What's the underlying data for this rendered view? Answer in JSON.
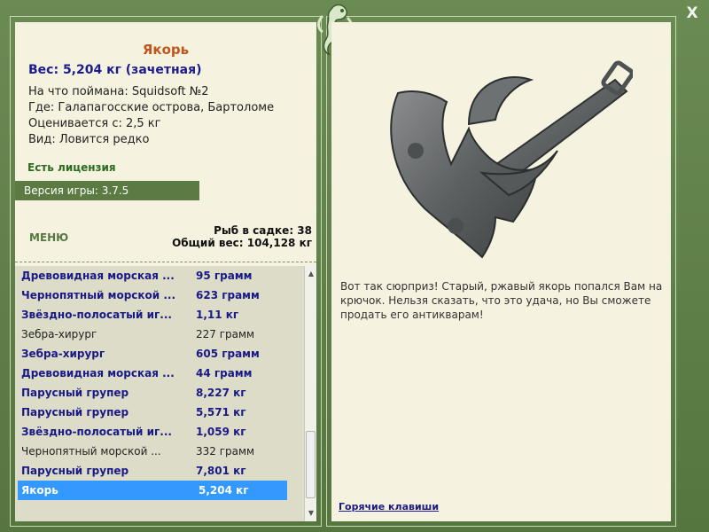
{
  "fish": {
    "title": "Якорь",
    "weight": "Вес: 5,204 кг (зачетная)",
    "info": [
      "На что поймана: Squidsoft №2",
      "Где: Галапагосские острова, Бартоломе",
      "Оценивается с: 2,5 кг",
      "Вид: Ловится редко"
    ],
    "description": "Вот так сюрприз! Старый, ржавый якорь попался Вам на крючок. Нельзя сказать, что это удача, но Вы сможете продать его антикварам!"
  },
  "license": "Есть лицензия",
  "version": "Версия игры: 3.7.5",
  "menu_label": "МЕНЮ",
  "stats": {
    "fish_count": "Рыб в садке: 38",
    "total_weight": "Общий вес: 104,128 кг"
  },
  "catch_list": [
    {
      "name": "Древовидная морская ...",
      "weight": "95 грамм",
      "style": "bold"
    },
    {
      "name": "Чернопятный морской ...",
      "weight": "623 грамм",
      "style": "bold"
    },
    {
      "name": "Звёздно-полосатый иг...",
      "weight": "1,11 кг",
      "style": "bold"
    },
    {
      "name": "Зебра-хирург",
      "weight": "227 грамм",
      "style": "normal"
    },
    {
      "name": "Зебра-хирург",
      "weight": "605 грамм",
      "style": "bold"
    },
    {
      "name": "Древовидная морская ...",
      "weight": "44 грамм",
      "style": "bold"
    },
    {
      "name": "Парусный групер",
      "weight": "8,227 кг",
      "style": "bold"
    },
    {
      "name": "Парусный групер",
      "weight": "5,571 кг",
      "style": "bold"
    },
    {
      "name": "Звёздно-полосатый иг...",
      "weight": "1,059 кг",
      "style": "bold"
    },
    {
      "name": "Чернопятный морской ...",
      "weight": "332 грамм",
      "style": "normal"
    },
    {
      "name": "Парусный групер",
      "weight": "7,801 кг",
      "style": "bold"
    },
    {
      "name": "Якорь",
      "weight": "5,204 кг",
      "style": "selected"
    }
  ],
  "hotkeys_label": "Горячие клавиши",
  "close_label": "X",
  "colors": {
    "frame": "#5f7f4a",
    "panel": "#f5f3df",
    "title_orange": "#c0561e",
    "blue_text": "#1a1a86",
    "selected_row": "#3399ff"
  },
  "icons": {
    "logo": "seahorse-logo-icon",
    "close": "close-icon",
    "anchor_image": "anchor-image"
  }
}
